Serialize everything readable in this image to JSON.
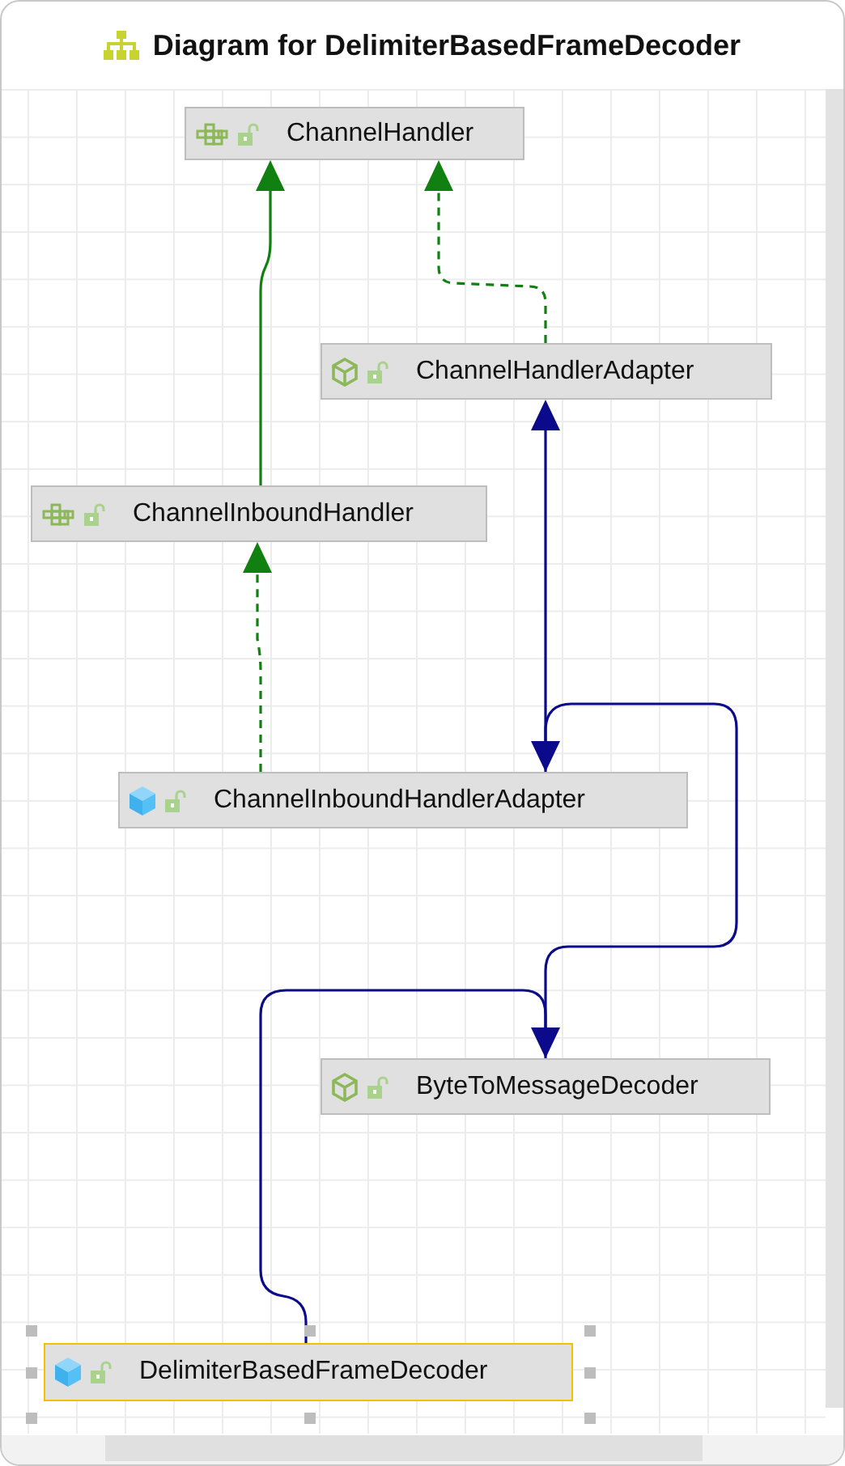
{
  "window": {
    "title": "Diagram for DelimiterBasedFrameDecoder"
  },
  "nodes": [
    {
      "name": "ChannelHandler",
      "kind": "interface",
      "selected": false
    },
    {
      "name": "ChannelHandlerAdapter",
      "kind": "abstract",
      "selected": false
    },
    {
      "name": "ChannelInboundHandler",
      "kind": "interface",
      "selected": false
    },
    {
      "name": "ChannelInboundHandlerAdapter",
      "kind": "class",
      "selected": false
    },
    {
      "name": "ByteToMessageDecoder",
      "kind": "abstract",
      "selected": false
    },
    {
      "name": "DelimiterBasedFrameDecoder",
      "kind": "class",
      "selected": true
    }
  ],
  "edges": [
    {
      "kind": "extends-interface"
    },
    {
      "kind": "implements"
    },
    {
      "kind": "implements"
    },
    {
      "kind": "extends"
    },
    {
      "kind": "extends"
    },
    {
      "kind": "extends"
    }
  ]
}
